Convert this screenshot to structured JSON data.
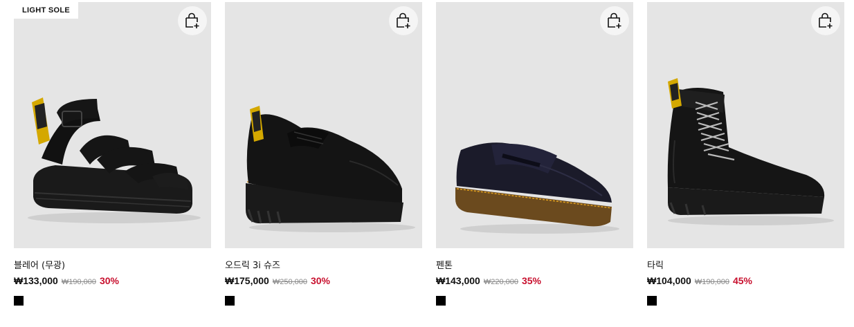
{
  "products": [
    {
      "badge": "LIGHT SOLE",
      "name": "블레어 (무광)",
      "sale_price": "₩133,000",
      "original_price": "₩190,000",
      "discount": "30%",
      "swatch_color": "#000000",
      "product_type": "sandal"
    },
    {
      "badge": "",
      "name": "오드릭 3i 슈즈",
      "sale_price": "₩175,000",
      "original_price": "₩250,000",
      "discount": "30%",
      "swatch_color": "#000000",
      "product_type": "derby-shoe"
    },
    {
      "badge": "",
      "name": "펜톤",
      "sale_price": "₩143,000",
      "original_price": "₩220,000",
      "discount": "35%",
      "swatch_color": "#000000",
      "product_type": "loafer"
    },
    {
      "badge": "",
      "name": "타릭",
      "sale_price": "₩104,000",
      "original_price": "₩190,000",
      "discount": "45%",
      "swatch_color": "#000000",
      "product_type": "boot"
    }
  ],
  "icons": {
    "cart": "add-to-cart-icon"
  },
  "colors": {
    "discount": "#c8102e",
    "image_bg": "#e5e5e5"
  }
}
